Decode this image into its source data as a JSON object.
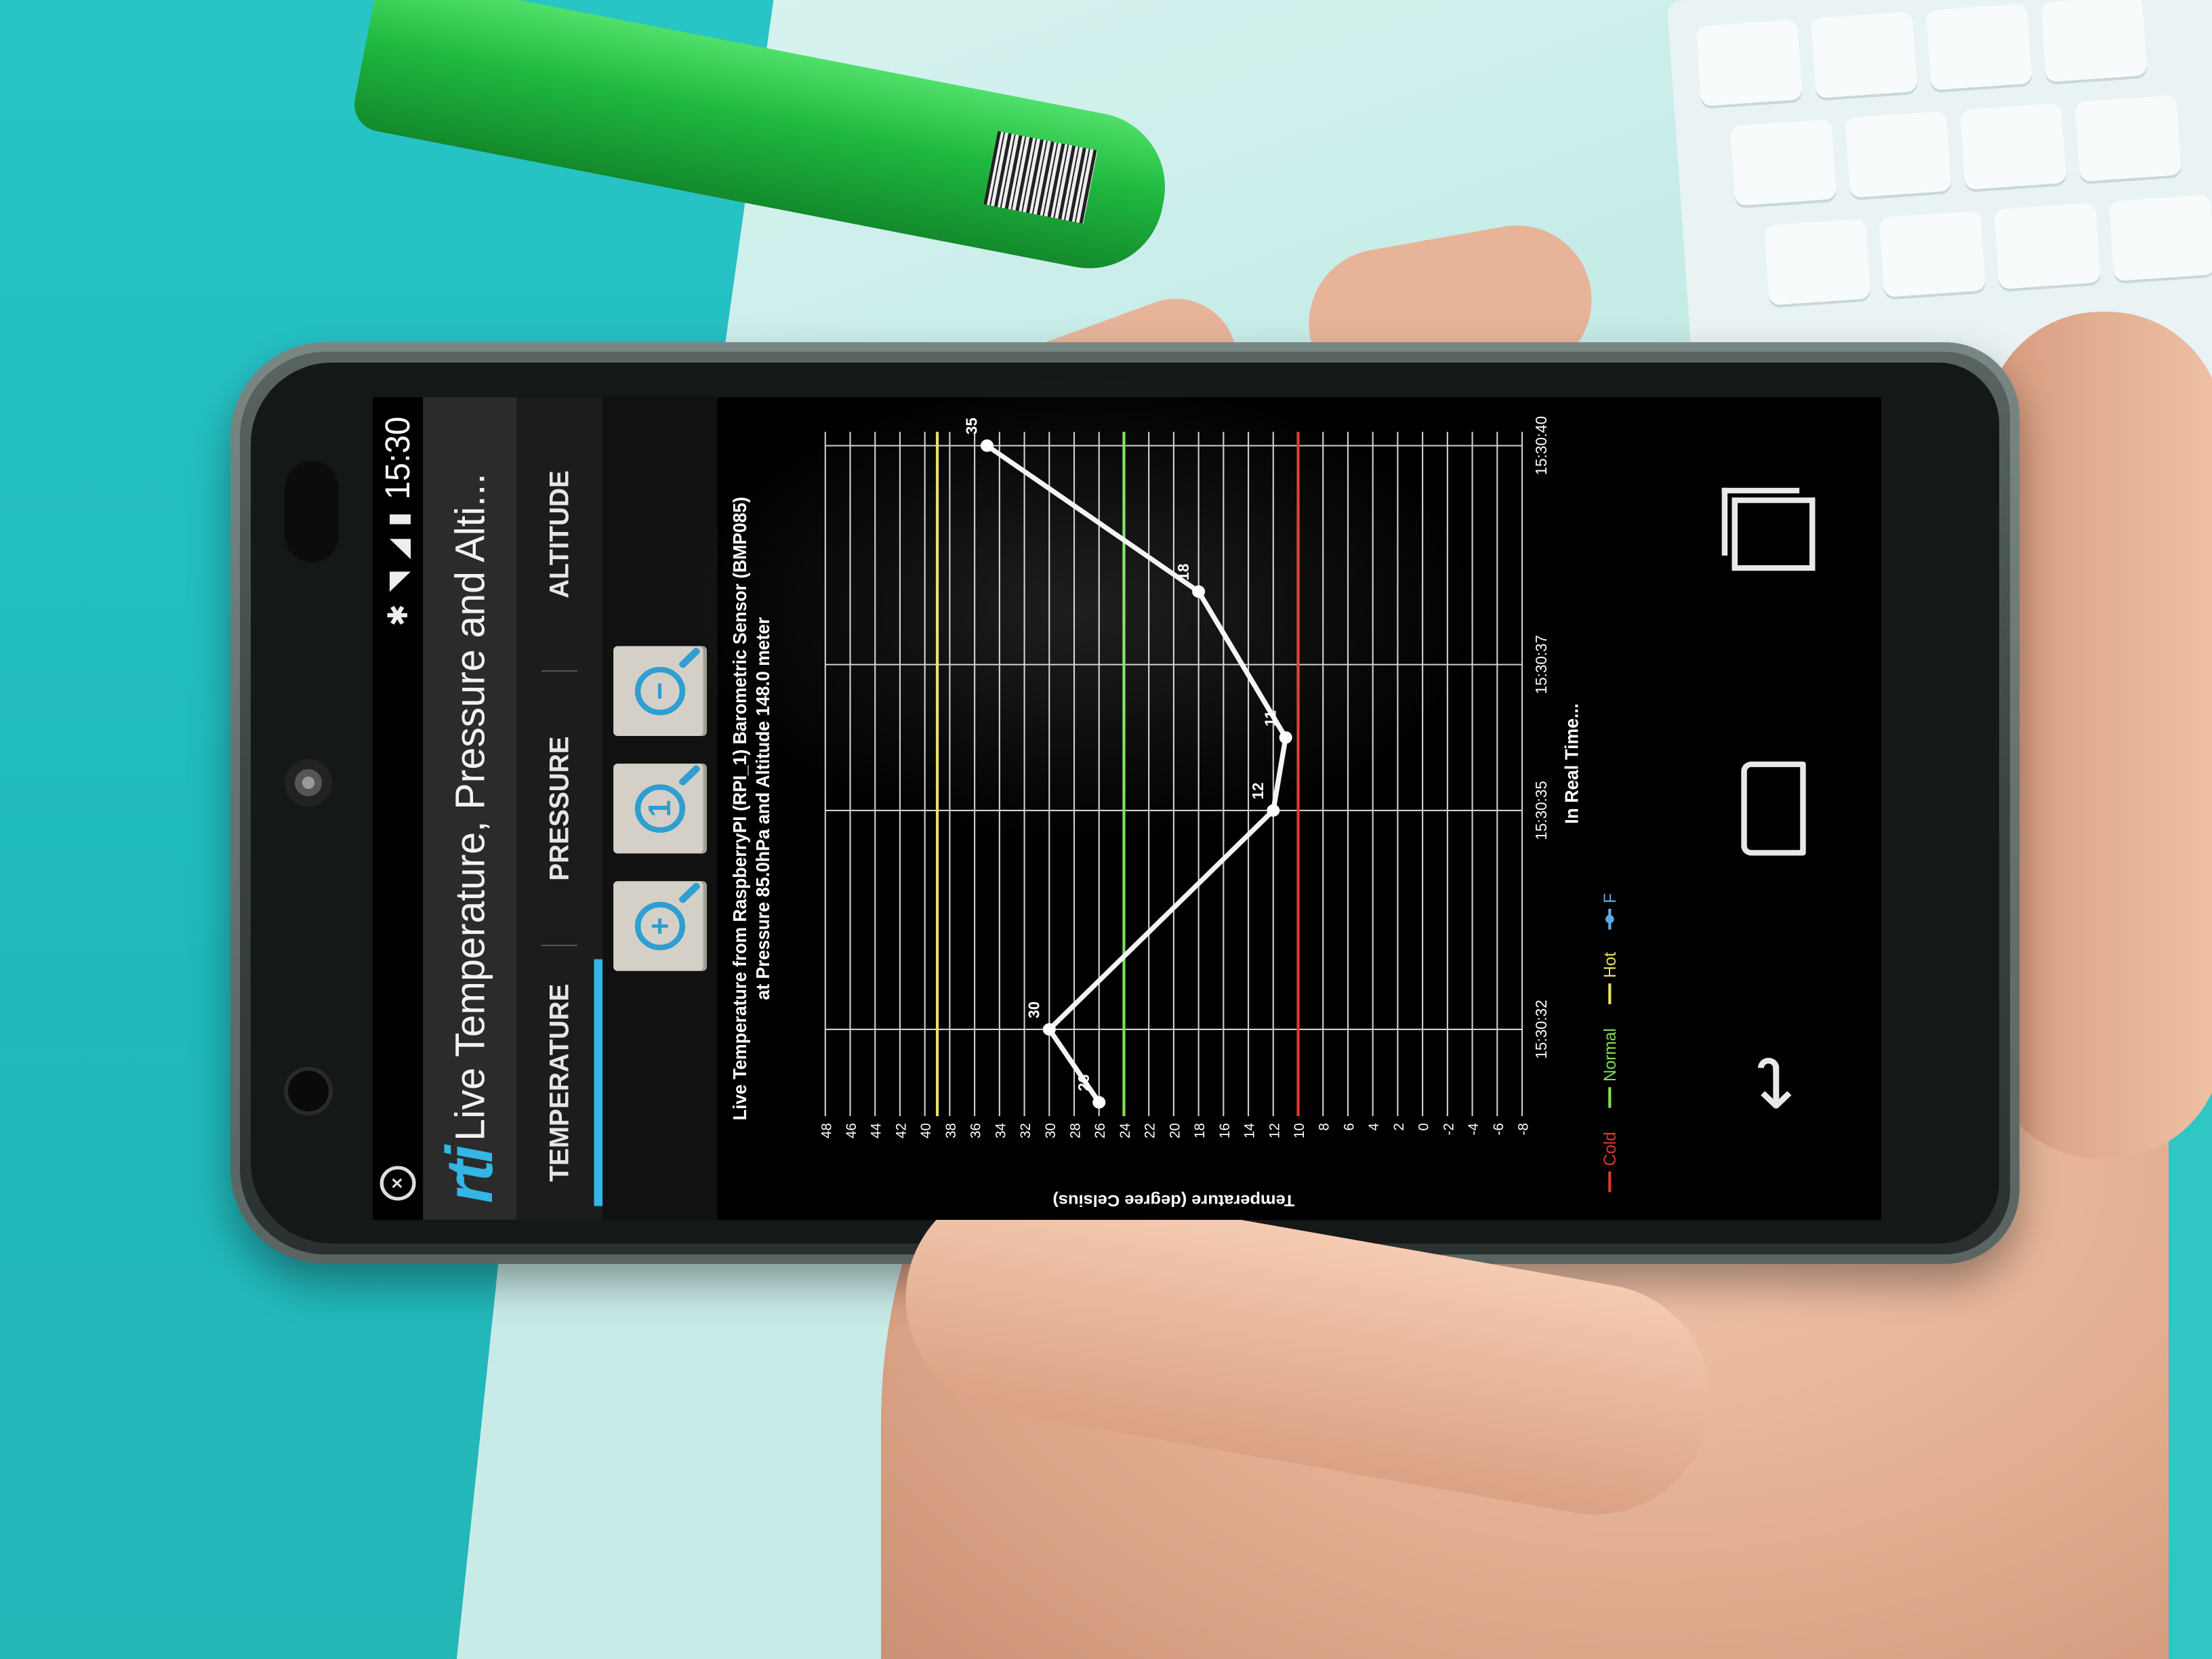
{
  "status_bar": {
    "time": "15:30",
    "icons": [
      "no-sim-icon",
      "bluetooth-icon",
      "wifi-icon",
      "signal-icon",
      "battery-icon"
    ]
  },
  "action_bar": {
    "logo_text": "rti",
    "title": "Live Temperature, Pressure and Alti..."
  },
  "tabs": [
    {
      "label": "TEMPERATURE",
      "active": true
    },
    {
      "label": "PRESSURE",
      "active": false
    },
    {
      "label": "ALTITUDE",
      "active": false
    }
  ],
  "zoom_buttons": [
    {
      "symbol": "+",
      "name": "zoom-in"
    },
    {
      "symbol": "1",
      "name": "zoom-reset"
    },
    {
      "symbol": "−",
      "name": "zoom-out"
    }
  ],
  "chart_data": {
    "type": "line",
    "title": "Live Temperature from RaspberryPI (RPI_1) Barometric Sensor (BMP085)",
    "subtitle": "at Pressure 85.0hPa and Altitude 148.0 meter",
    "xlabel": "In Real Time...",
    "ylabel": "Temperature (degree Celsius)",
    "x_ticks": [
      "15:30:32",
      "15:30:35",
      "15:30:37",
      "15:30:40"
    ],
    "y_ticks": [
      "-8",
      "-6",
      "-4",
      "-2",
      "0",
      "2",
      "4",
      "6",
      "8",
      "10",
      "12",
      "14",
      "16",
      "18",
      "20",
      "22",
      "24",
      "26",
      "28",
      "30",
      "32",
      "34",
      "36",
      "38",
      "40",
      "42",
      "44",
      "46",
      "48"
    ],
    "ylim": [
      -8,
      48
    ],
    "series": [
      {
        "name": "F",
        "points": [
          {
            "x": "15:30:31",
            "y": 26,
            "label": "26"
          },
          {
            "x": "15:30:32",
            "y": 30,
            "label": "30"
          },
          {
            "x": "15:30:35",
            "y": 12,
            "label": "12"
          },
          {
            "x": "15:30:36",
            "y": 11,
            "label": "11"
          },
          {
            "x": "15:30:38",
            "y": 18,
            "label": "18"
          },
          {
            "x": "15:30:40",
            "y": 35,
            "label": "35"
          }
        ]
      }
    ],
    "thresholds": [
      {
        "name": "Cold",
        "value": 10,
        "color": "#e03a2a"
      },
      {
        "name": "Normal",
        "value": 24,
        "color": "#7ee05a"
      },
      {
        "name": "Hot",
        "value": 39,
        "color": "#e8e060"
      }
    ],
    "legend": [
      "Cold",
      "Normal",
      "Hot",
      "F"
    ],
    "grid": true
  }
}
